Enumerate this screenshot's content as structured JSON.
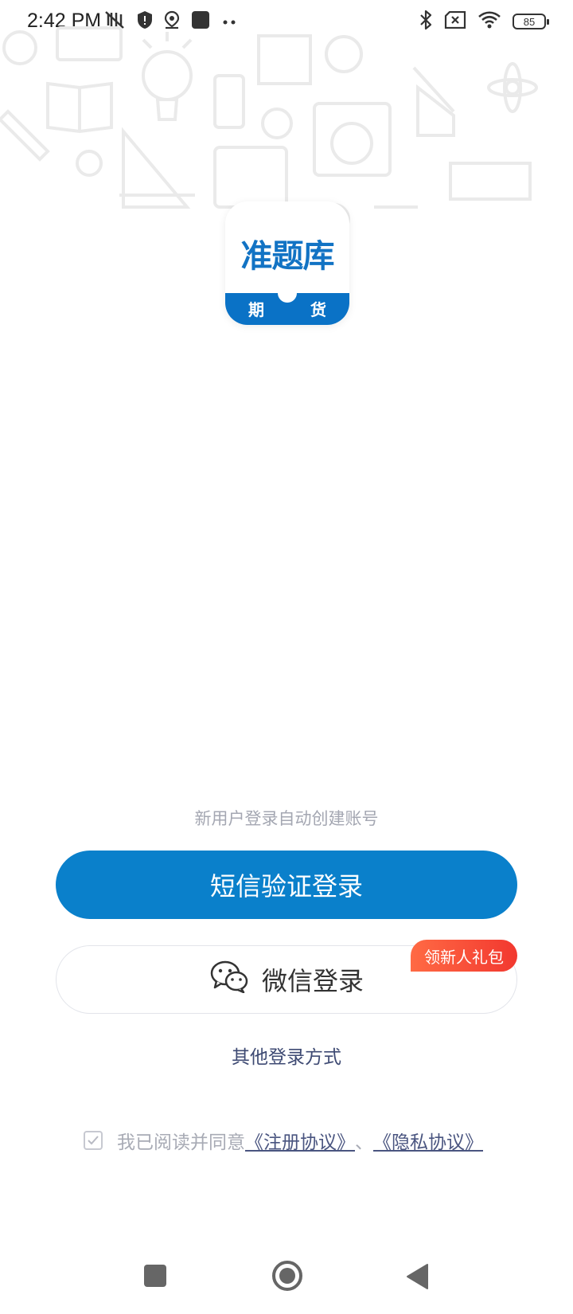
{
  "status_bar": {
    "time": "2:42 PM",
    "battery_level": "85",
    "left_icons": [
      "vibrate-off-icon",
      "shield-icon",
      "location-icon",
      "app-icon",
      "more-dots-icon"
    ],
    "right_icons": [
      "bluetooth-icon",
      "sim-off-icon",
      "wifi-icon",
      "battery-icon"
    ]
  },
  "logo": {
    "name": "准题库",
    "tag_left": "期",
    "tag_right": "货"
  },
  "login": {
    "hint": "新用户登录自动创建账号",
    "sms_button": "短信验证登录",
    "wechat_button": "微信登录",
    "gift_badge": "领新人礼包",
    "other_methods": "其他登录方式"
  },
  "agreement": {
    "prefix": "我已阅读并同意",
    "register_link": "《注册协议》",
    "separator": "、",
    "privacy_link": "《隐私协议》",
    "checked": true
  },
  "nav_bar": {
    "icons": [
      "recents-icon",
      "home-icon",
      "back-icon"
    ]
  },
  "colors": {
    "primary": "#0a80cb",
    "badge": "#f2382f",
    "link": "#4a5580",
    "hint": "#a4a7b2"
  }
}
